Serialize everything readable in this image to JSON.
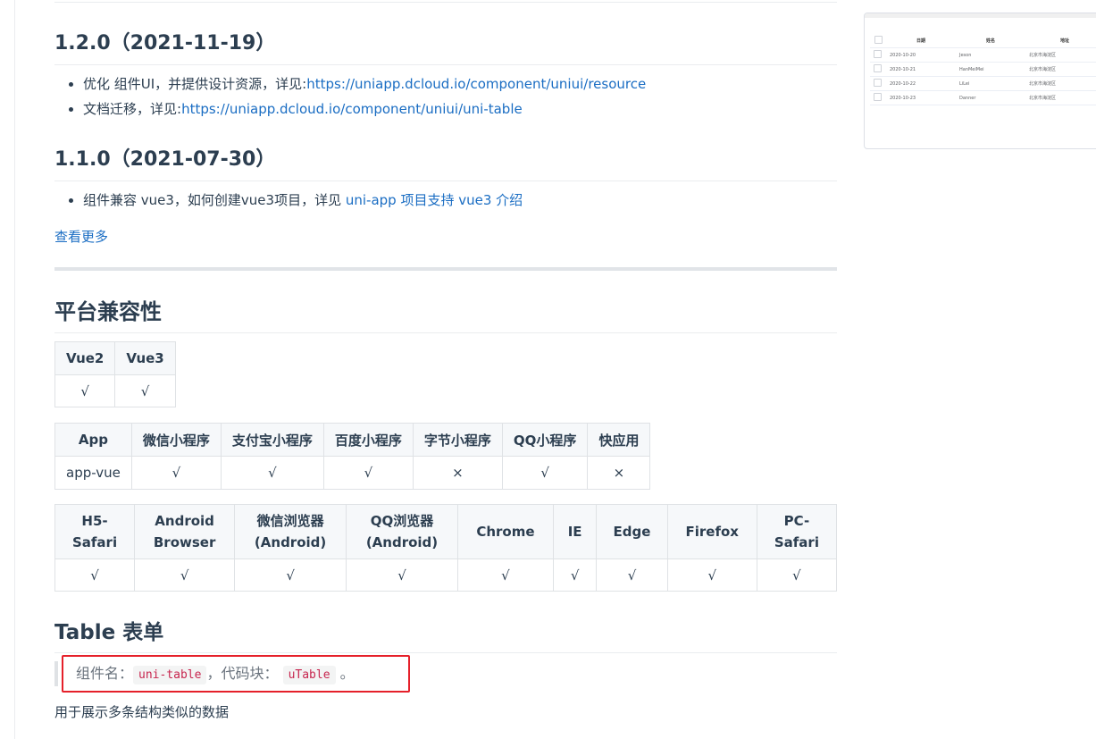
{
  "changelog": [
    {
      "version": "1.2.0（2021-11-19）",
      "items": [
        {
          "text": "优化 组件UI，并提供设计资源，详见:",
          "link": "https://uniapp.dcloud.io/component/uniui/resource"
        },
        {
          "text": "文档迁移，详见:",
          "link": "https://uniapp.dcloud.io/component/uniui/uni-table"
        }
      ]
    },
    {
      "version": "1.1.0（2021-07-30）",
      "items": [
        {
          "text": "组件兼容 vue3，如何创建vue3项目，详见 ",
          "link": "uni-app 项目支持 vue3 介绍"
        }
      ]
    }
  ],
  "more_link": "查看更多",
  "compat_title": "平台兼容性",
  "vue_table": {
    "headers": [
      "Vue2",
      "Vue3"
    ],
    "row": [
      "√",
      "√"
    ]
  },
  "app_table": {
    "headers": [
      "App",
      "微信小程序",
      "支付宝小程序",
      "百度小程序",
      "字节小程序",
      "QQ小程序",
      "快应用"
    ],
    "row": [
      "app-vue",
      "√",
      "√",
      "√",
      "×",
      "√",
      "×"
    ]
  },
  "web_table": {
    "headers": [
      "H5-\nSafari",
      "Android\nBrowser",
      "微信浏览器\n(Android)",
      "QQ浏览器\n(Android)",
      "Chrome",
      "IE",
      "Edge",
      "Firefox",
      "PC-\nSafari"
    ],
    "row": [
      "√",
      "√",
      "√",
      "√",
      "√",
      "√",
      "√",
      "√",
      "√"
    ]
  },
  "table_title": "Table 表单",
  "callout": {
    "prefix": "组件名：",
    "component": "uni-table",
    "middle": "，代码块： ",
    "snippet": "uTable",
    "suffix": " 。"
  },
  "description": "用于展示多条结构类似的数据",
  "preview": {
    "headers": [
      "日期",
      "姓名",
      "地址"
    ],
    "rows": [
      [
        "2020-10-20",
        "Jeson",
        "北京市海淀区"
      ],
      [
        "2020-10-21",
        "HanMeiMei",
        "北京市海淀区"
      ],
      [
        "2020-10-22",
        "LiLei",
        "北京市海淀区"
      ],
      [
        "2020-10-23",
        "Danner",
        "北京市海淀区"
      ]
    ]
  }
}
